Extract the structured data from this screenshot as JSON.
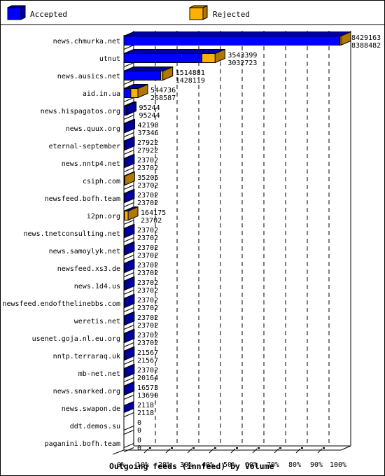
{
  "legend": [
    {
      "label": "Accepted",
      "color": "#0000ff",
      "side_color": "#0000a0"
    },
    {
      "label": "Rejected",
      "color": "#ffb000",
      "side_color": "#b07800"
    }
  ],
  "chart_data": {
    "type": "bar",
    "orientation": "horizontal",
    "stacked": true,
    "title": "Outgoing feeds (innfeed) by Volume",
    "xlabel": "",
    "ylabel": "",
    "xlim": [
      0,
      100
    ],
    "x_unit": "%",
    "x_ticks": [
      "0%",
      "10%",
      "20%",
      "30%",
      "40%",
      "50%",
      "60%",
      "70%",
      "80%",
      "90%",
      "100%"
    ],
    "grid": true,
    "legend_position": "top",
    "max_total": 8429163,
    "categories": [
      "news.chmurka.net",
      "utnut",
      "news.ausics.net",
      "aid.in.ua",
      "news.hispagatos.org",
      "news.quux.org",
      "eternal-september",
      "news.nntp4.net",
      "csiph.com",
      "newsfeed.bofh.team",
      "i2pn.org",
      "news.tnetconsulting.net",
      "news.samoylyk.net",
      "newsfeed.xs3.de",
      "news.1d4.us",
      "newsfeed.endofthelinebbs.com",
      "weretis.net",
      "usenet.goja.nl.eu.org",
      "nntp.terraraq.uk",
      "mb-net.net",
      "news.snarked.org",
      "news.swapon.de",
      "ddt.demos.su",
      "paganini.bofh.team"
    ],
    "series": [
      {
        "name": "Accepted",
        "values": [
          8388482,
          3032723,
          1428119,
          268587,
          95244,
          37346,
          27922,
          23702,
          23702,
          23702,
          23702,
          23702,
          23702,
          23702,
          23702,
          23702,
          23702,
          23702,
          21567,
          20164,
          13690,
          2118,
          0,
          0
        ]
      },
      {
        "name": "Rejected",
        "values": [
          40681,
          510676,
          86762,
          276149,
          0,
          4844,
          0,
          0,
          11503,
          0,
          140473,
          0,
          0,
          0,
          0,
          0,
          0,
          0,
          0,
          3538,
          2883,
          0,
          0,
          0
        ]
      }
    ],
    "totals": [
      8429163,
      3543399,
      1514881,
      544736,
      95244,
      42190,
      27922,
      23702,
      35205,
      23702,
      164175,
      23702,
      23702,
      23702,
      23702,
      23702,
      23702,
      23702,
      21567,
      23702,
      16573,
      2118,
      0,
      0
    ],
    "data_labels_top": [
      "8429163",
      "3543399",
      "1514881",
      "544736",
      "95244",
      "42190",
      "27922",
      "23702",
      "35205",
      "23702",
      "164175",
      "23702",
      "23702",
      "23702",
      "23702",
      "23702",
      "23702",
      "23702",
      "21567",
      "23702",
      "16573",
      "2118",
      "0",
      "0"
    ],
    "data_labels_bottom": [
      "8388482",
      "3032723",
      "1428119",
      "268587",
      "95244",
      "37346",
      "27922",
      "23702",
      "23702",
      "23702",
      "23702",
      "23702",
      "23702",
      "23702",
      "23702",
      "23702",
      "23702",
      "23702",
      "21567",
      "20164",
      "13690",
      "2118",
      "0",
      "0"
    ]
  }
}
